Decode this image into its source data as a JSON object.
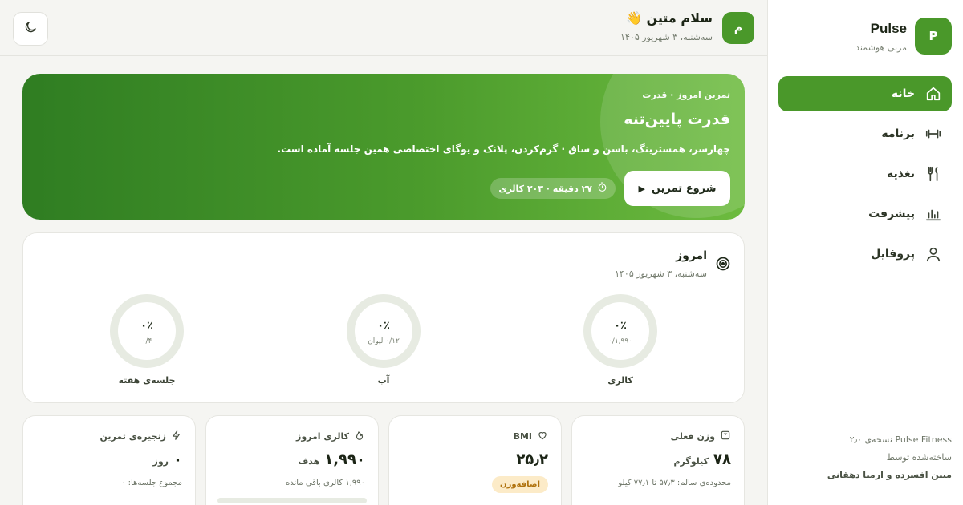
{
  "sidebar": {
    "brand_initial": "P",
    "brand_name": "Pulse",
    "brand_subtitle": "مربی هوشمند",
    "items": [
      {
        "label": "خانه",
        "icon": "home-icon",
        "active": true
      },
      {
        "label": "برنامه",
        "icon": "dumbbell-icon",
        "active": false
      },
      {
        "label": "تغذیه",
        "icon": "fork-knife-icon",
        "active": false
      },
      {
        "label": "پیشرفت",
        "icon": "bar-chart-icon",
        "active": false
      },
      {
        "label": "پروفایل",
        "icon": "user-icon",
        "active": false
      }
    ],
    "footer": {
      "version": "Pulse Fitness نسخه‌ی ۲٫۰",
      "made_by": "ساخته‌شده توسط",
      "authors": "مبین افسرده و ارمیا دهقانی"
    }
  },
  "header": {
    "avatar_initial": "م",
    "greeting": "سلام متین 👋",
    "date": "سه‌شنبه، ۳ شهریور ۱۴۰۵",
    "theme_icon": "moon-icon"
  },
  "hero": {
    "kicker": "تمرین امروز · قدرت",
    "title": "قدرت پایین‌تنه",
    "description": "چهارسر، همسترینگ، باسن و ساق · گرم‌کردن، پلانک و یوگای اختصاصی همین جلسه آماده است.",
    "start_label": "شروع تمرین",
    "meta": "۲۷ دقیقه · ۲۰۳ کالری"
  },
  "today": {
    "title": "امروز",
    "date": "سه‌شنبه، ۳ شهریور ۱۴۰۵",
    "rings": [
      {
        "pct": "۰٪",
        "sub": "۰/۱,۹۹۰",
        "label": "کالری",
        "progress": 0
      },
      {
        "pct": "۰٪",
        "sub": "۰/۱۲ لیوان",
        "label": "آب",
        "progress": 0
      },
      {
        "pct": "۰٪",
        "sub": "۰/۴",
        "label": "جلسه‌ی هفته",
        "progress": 0
      }
    ]
  },
  "stats": [
    {
      "title": "وزن فعلی",
      "icon": "scale-icon",
      "value": "۷۸",
      "unit": "کیلوگرم",
      "note": "محدوده‌ی سالم: ۵۷٫۳ تا ۷۷٫۱ کیلو"
    },
    {
      "title": "BMI",
      "icon": "heart-icon",
      "value": "۲۵٫۲",
      "badge": "اضافه‌وزن"
    },
    {
      "title": "کالری امروز",
      "icon": "flame-icon",
      "value": "۱,۹۹۰",
      "unit": "هدف",
      "note": "۱,۹۹۰ کالری باقی مانده",
      "progress": 0
    },
    {
      "title": "زنجیره‌ی تمرین",
      "icon": "bolt-icon",
      "value": "۰",
      "unit": "روز",
      "note": "مجموع جلسه‌ها: ۰"
    }
  ],
  "colors": {
    "accent": "#4a982a",
    "ring_track": "#e7ebe2",
    "badge_bg": "#fcebc8",
    "badge_text": "#b0730f"
  }
}
